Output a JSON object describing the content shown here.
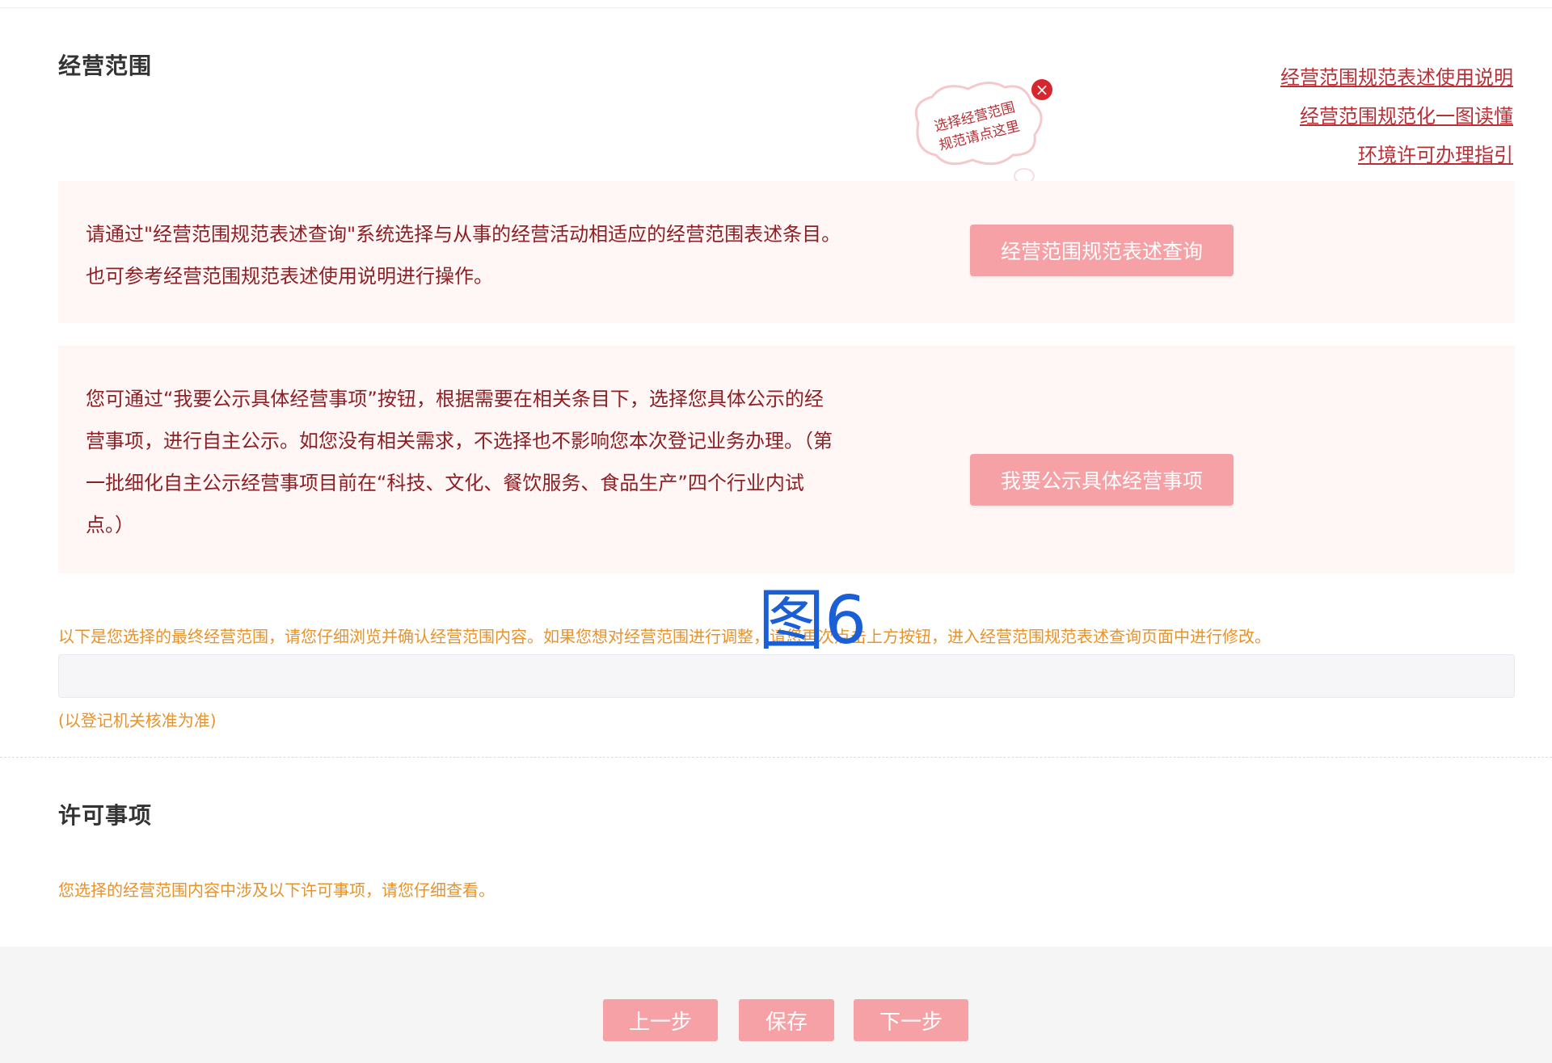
{
  "business_scope": {
    "title": "经营范围",
    "links": [
      "经营范围规范表述使用说明",
      "经营范围规范化一图读懂",
      "环境许可办理指引"
    ],
    "bubble": {
      "line1": "选择经营范围",
      "line2": "规范请点这里"
    },
    "panel1": {
      "line1": "请通过\"经营范围规范表述查询\"系统选择与从事的经营活动相适应的经营范围表述条目。",
      "line2": "也可参考经营范围规范表述使用说明进行操作。",
      "button": "经营范围规范表述查询"
    },
    "panel2": {
      "lines": [
        "您可通过“我要公示具体经营事项”按钮，根据需要在相关条目下，选择您具体公示的经",
        "营事项，进行自主公示。如您没有相关需求，不选择也不影响您本次登记业务办理。（第",
        "一批细化自主公示经营事项目前在“科技、文化、餐饮服务、食品生产”四个行业内试",
        "点。）"
      ],
      "button": "我要公示具体经营事项"
    },
    "final_note": "以下是您选择的最终经营范围，请您仔细浏览并确认经营范围内容。如果您想对经营范围进行调整，请您再次点击上方按钮，进入经营范围规范表述查询页面中进行修改。",
    "remark": "(以登记机关核准为准)"
  },
  "watermark": "图6",
  "license": {
    "title": "许可事项",
    "note": "您选择的经营范围内容中涉及以下许可事项，请您仔细查看。"
  },
  "footer": {
    "prev": "上一步",
    "save": "保存",
    "next": "下一步"
  },
  "colors": {
    "accent_button": "#f6a1a6",
    "link": "#b83036",
    "panel_bg": "#fff6f6",
    "note": "#e8932a",
    "panel_text": "#8e1f24"
  }
}
